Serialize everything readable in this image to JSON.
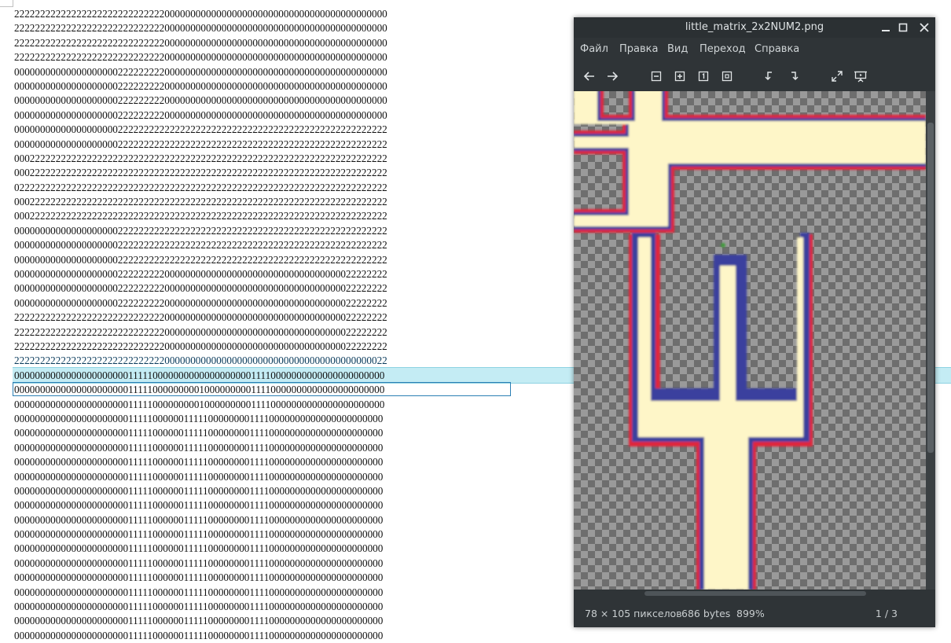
{
  "document": {
    "lines": [
      "222222222222222222222222222220000000000000000000000000000000000000000000",
      "222222222222222222222222222220000000000000000000000000000000000000000000",
      "222222222222222222222222222220000000000000000000000000000000000000000000",
      "222222222222222222222222222220000000000000000000000000000000000000000000",
      "000000000000000000002222222220000000000000000000000000000000000000000000",
      "000000000000000000002222222220000000000000000000000000000000000000000000",
      "000000000000000000002222222220000000000000000000000000000000000000000000",
      "000000000000000000002222222220000000000000000000000000000000000000000000",
      "000000000000000000002222222222222222222222222222222222222222222222222222",
      "000000000000000000002222222222222222222222222222222222222222222222222222",
      "000222222222222222222222222222222222222222222222222222222222222222222222",
      "000222222222222222222222222222222222222222222222222222222222222222222222",
      "022222222222222222222222222222222222222222222222222222222222222222222222",
      "000222222222222222222222222222222222222222222222222222222222222222222222",
      "000222222222222222222222222222222222222222222222222222222222222222222222",
      "000000000000000000002222222222222222222222222222222222222222222222222222",
      "000000000000000000002222222222222222222222222222222222222222222222222222",
      "000000000000000000002222222222222222222222222222222222222222222222222222",
      "000000000000000000002222222220000000000000000000000000000000000022222222",
      "000000000000000000002222222220000000000000000000000000000000000022222222",
      "000000000000000000002222222220000000000000000000000000000000000022222222",
      "222222222222222222222222222220000000000000000000000000000000000022222222",
      "222222222222222222222222222220000000000000000000000000000000000022222222",
      "222222222222222222222222222220000000000000000000000000000000000022222222",
      "222222222222222222222222222220000000000000000000000000000000000000000022",
      "000000000000000000000011111000000000000000000011110000000000000000000000",
      "000000000000000000000011111000000000100000000011110000000000000000000000",
      "000000000000000000000011111000000000100000000011110000000000000000000000",
      "000000000000000000000011111000000111110000000011110000000000000000000000",
      "000000000000000000000011111000000111110000000011110000000000000000000000",
      "000000000000000000000011111000000111110000000011110000000000000000000000",
      "000000000000000000000011111000000111110000000011110000000000000000000000",
      "000000000000000000000011111000000111110000000011110000000000000000000000",
      "000000000000000000000011111000000111110000000011110000000000000000000000",
      "000000000000000000000011111000000111110000000011110000000000000000000000",
      "000000000000000000000011111000000111110000000011110000000000000000000000",
      "000000000000000000000011111000000111110000000011110000000000000000000000",
      "000000000000000000000011111000000111110000000011110000000000000000000000",
      "000000000000000000000011111000000111110000000011110000000000000000000000",
      "000000000000000000000011111000000111110000000011110000000000000000000000",
      "000000000000000000000011111000000111110000000011110000000000000000000000",
      "000000000000000000000011111000000111110000000011110000000000000000000000",
      "000000000000000000000011111000000111110000000011110000000000000000000000",
      "000000000000000000000011111000000111110000000011110000000000000000000000"
    ],
    "active_line_index": 24,
    "selected_line_index": 25
  },
  "viewer": {
    "title": "little_matrix_2x2NUM2.png",
    "menu": [
      "Файл",
      "Правка",
      "Вид",
      "Переход",
      "Справка"
    ],
    "toolbar_icons": [
      "back-icon",
      "forward-icon",
      "zoom-out-icon",
      "zoom-in-icon",
      "zoom-normal-icon",
      "zoom-fit-icon",
      "rotate-left-icon",
      "rotate-right-icon",
      "fullscreen-icon",
      "slideshow-icon"
    ],
    "status": {
      "dimensions": "78 × 105 пикселов",
      "size": "686 bytes",
      "zoom": "899%",
      "page": "1 / 3"
    },
    "colors": {
      "fill": "#fef6c8",
      "outline_red": "#e0263a",
      "outline_blue": "#3b3f9e",
      "marker_green": "#3f9a3a"
    }
  }
}
